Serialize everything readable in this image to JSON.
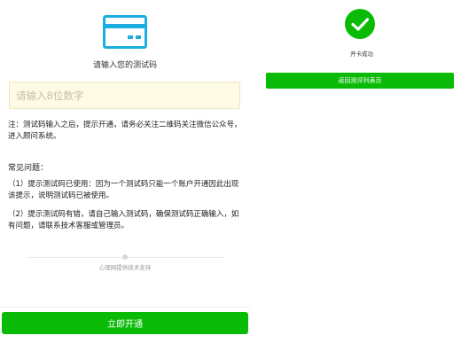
{
  "colors": {
    "accent": "#1aade0",
    "primary_green": "#09bb07",
    "input_bg": "#fdfbe6"
  },
  "left_panel": {
    "icon": "credit-card-icon",
    "prompt": "请输入您的测试码",
    "input": {
      "placeholder": "请输入8位数字",
      "value": ""
    },
    "note": "注：测试码输入之后，提示开通，请务必关注二维码关注微信公众号，进入顾问系统。",
    "faq": {
      "title": "常见问题：",
      "items": [
        "（1）提示测试码已使用：因为一个测试码只能一个账户开通因此出现该提示，说明测试码已被使用。",
        "（2）提示测试码有错，请自己输入测试码，确保测试码正确输入，如有问题，请联系技术客服或管理员。"
      ]
    },
    "support_text": "心理网提供技术支持",
    "open_button": "立即开通"
  },
  "right_panel": {
    "icon": "check-circle-icon",
    "success_text": "开卡成功",
    "return_button": "返回测评列表页"
  }
}
